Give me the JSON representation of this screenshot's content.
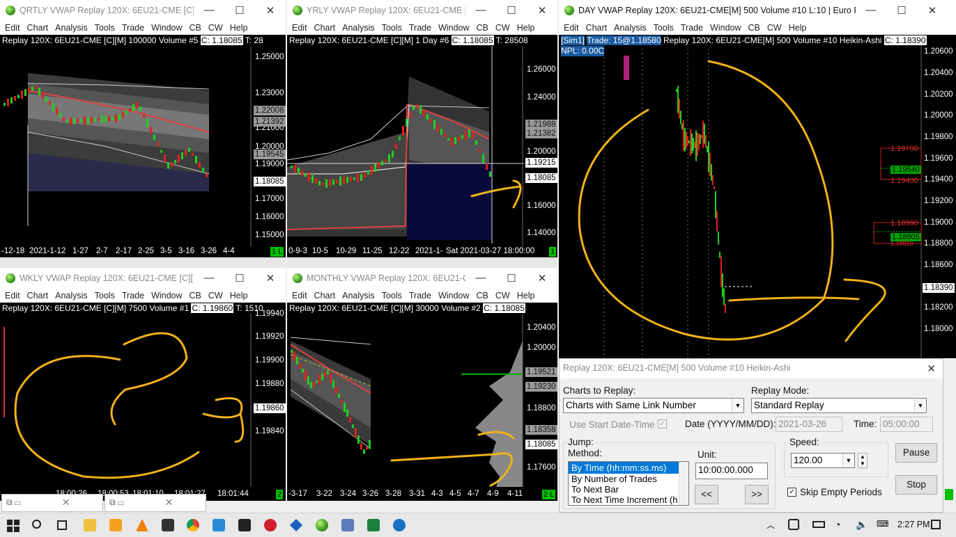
{
  "menu": [
    "Edit",
    "Chart",
    "Analysis",
    "Tools",
    "Trade",
    "Window",
    "CB",
    "CW",
    "Help"
  ],
  "win_controls": [
    "—",
    "☐",
    "✕"
  ],
  "qrtly": {
    "title": "QRTLY VWAP Replay 120X: 6EU21-CME [C][...",
    "info": "Replay 120X: 6EU21-CME [C][M]  100000 Volume  #5",
    "close": "C: 1.18085",
    "t": "T: 28",
    "ticks": [
      "1.25000",
      "1.23000",
      "1.21000",
      "1.20000",
      "1.19000",
      "1.17000",
      "1.16000",
      "1.15000"
    ],
    "boxes": [
      "1.22008",
      "1.21392",
      "1.19545"
    ],
    "price": "1.18085",
    "dates": [
      "-12-18",
      "2021-1-12",
      "1-27",
      "2-7",
      "2-17",
      "2-25",
      "3-5",
      "3-16",
      "3-26",
      "4-4"
    ],
    "badge": "1 L"
  },
  "yrly": {
    "title": "YRLY VWAP Replay 120X: 6EU21-CME [C...",
    "info": "Replay 120X: 6EU21-CME [C][M]  1 Day  #6",
    "close": "C: 1.18085",
    "t": "T: 28508",
    "ticks": [
      "1.26000",
      "1.24000",
      "1.20000",
      "1.16000",
      "1.14000"
    ],
    "boxes": [
      "1.21988",
      "1.21382"
    ],
    "cross": "1.19215",
    "price": "1.18085",
    "dates": [
      "0-9-3",
      "10-5",
      "10-29",
      "11-25",
      "12-22",
      "2021-1-"
    ],
    "crossdate": "Sat 2021-03-27   18:00:00",
    "badge": "1"
  },
  "day": {
    "title": "DAY VWAP  Replay 120X: 6EU21-CME[M]  500 Volume  #10 L:10 | Euro FX -...",
    "sim": "[Sim1]",
    "trade": "Trade: 15@1.18580",
    "info": "Replay 120X: 6EU21-CME[M]  500 Volume  #10 Heikin-Ashi",
    "close": "C: 1.18390",
    "npl": "NPL: 0.00C",
    "ticks": [
      "1.20600",
      "1.20400",
      "1.20200",
      "1.20000",
      "1.19800",
      "1.19600",
      "1.19400",
      "1.19200",
      "1.19000",
      "1.18800",
      "1.18600",
      "1.18200",
      "1.18000"
    ],
    "price": "1.18390",
    "orders": [
      "1.19700",
      "1.19540",
      "1.19400",
      "1.18990",
      "1.18905",
      "1.18810"
    ]
  },
  "wkly": {
    "title": "WKLY VWAP Replay 120X: 6EU21-CME [C][M...",
    "info": "Replay 120X: 6EU21-CME [C][M]  7500 Volume  #1",
    "close": "C: 1.19860",
    "t": "T: 1510",
    "ticks": [
      "1.19940",
      "1.19920",
      "1.19900",
      "1.19880",
      "1.19840"
    ],
    "price": "1.19860",
    "dates": [
      "18:00:26",
      "18:00:53",
      "18:01:10",
      "18:01:27",
      "18:01:44"
    ],
    "badge": "2"
  },
  "monthly": {
    "title": "MONTHLY VWAP Replay 120X: 6EU21-C...",
    "info": "Replay 120X: 6EU21-CME [C][M]  30000 Volume  #2",
    "close": "C: 1.18085",
    "ticks": [
      "1.20400",
      "1.20000",
      "1.18800",
      "1.17600"
    ],
    "boxes": [
      "1.19521",
      "1.19230",
      "1.18358"
    ],
    "price": "1.18085",
    "dates": [
      "-3-17",
      "3-22",
      "3-24",
      "3-26",
      "3-28",
      "3-31",
      "4-3",
      "4-5",
      "4-7",
      "4-9",
      "4-11"
    ],
    "badge": "2 L"
  },
  "dialog": {
    "title": "Replay 120X: 6EU21-CME[M]  500 Volume  #10 Heikin-Ashi",
    "charts_label": "Charts to Replay:",
    "charts_value": "Charts with Same Link Number",
    "mode_label": "Replay Mode:",
    "mode_value": "Standard Replay",
    "use_start": "Use Start Date-Time",
    "date_label": "Date (YYYY/MM/DD):",
    "date_value": "2021-03-26",
    "time_label": "Time:",
    "time_value": "05:00:00",
    "jump": "Jump:",
    "method": "Method:",
    "methods": [
      "By Time (hh:mm:ss.ms)",
      "By Number of Trades",
      "To Next Bar",
      "To Next Time Increment (h"
    ],
    "unit_label": "Unit:",
    "unit_value": "10:00:00.000",
    "back": "<<",
    "fwd": ">>",
    "speed_label": "Speed:",
    "speed_value": "120.00",
    "pause": "Pause",
    "stop": "Stop",
    "skip": "Skip Empty Periods"
  },
  "taskbar": {
    "time": "2:27 PM"
  }
}
